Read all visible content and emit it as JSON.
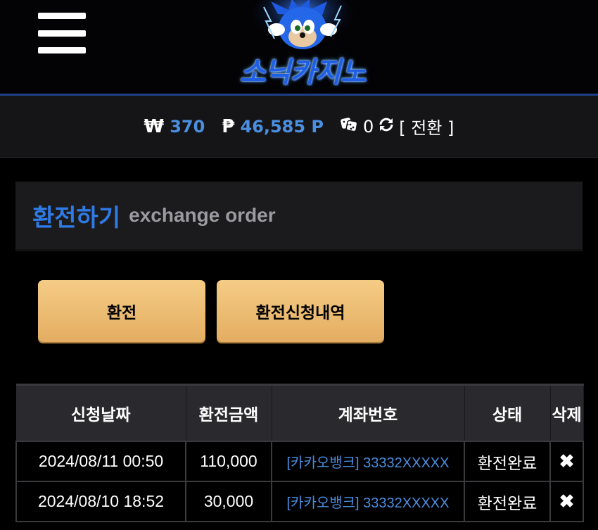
{
  "header": {
    "logo_text": "소닉카지노"
  },
  "balance": {
    "won_symbol": "₩",
    "won_value": "370",
    "point_symbol": "₱",
    "point_value": "46,585 P",
    "chip_value": "0",
    "convert_label": "[ 전환 ]"
  },
  "section": {
    "title": "환전하기",
    "subtitle": "exchange order"
  },
  "buttons": {
    "exchange": "환전",
    "history": "환전신청내역"
  },
  "table": {
    "headers": [
      "신청날짜",
      "환전금액",
      "계좌번호",
      "상태",
      "삭제"
    ],
    "rows": [
      {
        "date": "2024/08/11 00:50",
        "amount": "110,000",
        "account": "[카카오뱅크] 33332XXXXX",
        "status": "환전완료",
        "delete": "✖"
      },
      {
        "date": "2024/08/10 18:52",
        "amount": "30,000",
        "account": "[카카오뱅크] 33332XXXXX",
        "status": "환전완료",
        "delete": "✖"
      }
    ]
  }
}
